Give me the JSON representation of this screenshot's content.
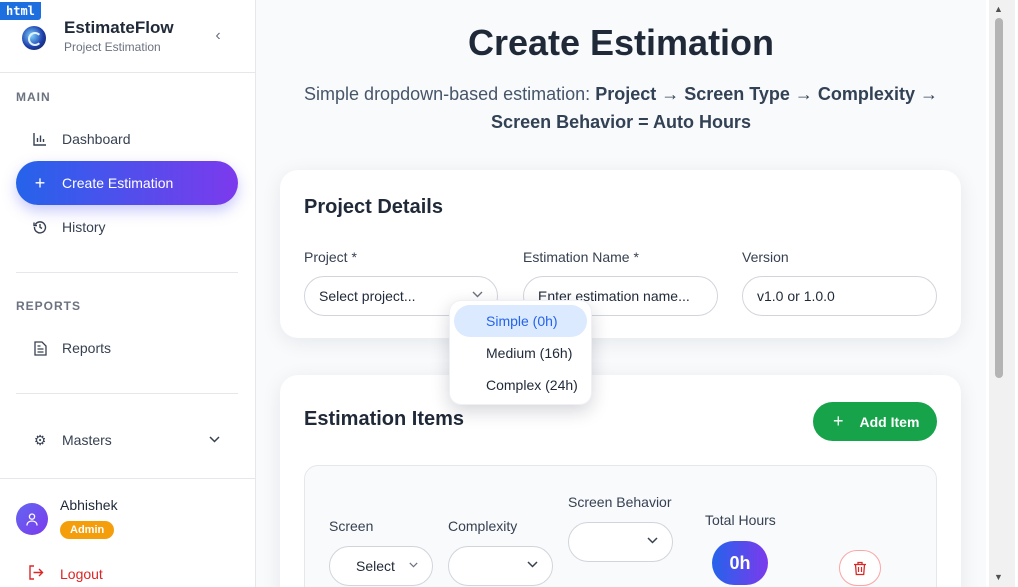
{
  "overlay": {
    "tag": "html"
  },
  "brand": {
    "title": "EstimateFlow",
    "subtitle": "Project Estimation",
    "logo_icon": "swirl-logo-icon"
  },
  "sidebar": {
    "collapse_icon": "chevron-left-icon",
    "main_label": "MAIN",
    "main_items": [
      {
        "label": "Dashboard",
        "icon": "bar-chart-icon"
      },
      {
        "label": "Create Estimation",
        "icon": "plus-icon",
        "active": true
      },
      {
        "label": "History",
        "icon": "history-icon"
      }
    ],
    "reports_label": "REPORTS",
    "reports_items": [
      {
        "label": "Reports",
        "icon": "document-icon"
      }
    ],
    "masters": {
      "label": "Masters",
      "icon": "gear-icon"
    },
    "user": {
      "name": "Abhishek",
      "role": "Admin"
    },
    "logout": "Logout"
  },
  "page": {
    "title": "Create Estimation",
    "subtitle_prefix": "Simple dropdown-based estimation: ",
    "subtitle_flow": "Project → Screen Type → Complexity → Screen Behavior = Auto Hours"
  },
  "project_details": {
    "title": "Project Details",
    "project_label": "Project *",
    "project_value": "Select project...",
    "name_label": "Estimation Name *",
    "name_placeholder": "Enter estimation name...",
    "version_label": "Version",
    "version_placeholder": "v1.0 or 1.0.0"
  },
  "dropdown": {
    "options": [
      "Simple (0h)",
      "Medium (16h)",
      "Complex (24h)"
    ],
    "selected": "Simple (0h)"
  },
  "estimation_items": {
    "title": "Estimation Items",
    "add_button": "Add Item",
    "columns": {
      "screen": "Screen",
      "complexity": "Complexity",
      "behavior": "Screen Behavior",
      "total": "Total Hours"
    },
    "row": {
      "screen_value": "Select",
      "complexity_value": "",
      "behavior_value": "",
      "total_hours": "0h"
    }
  },
  "colors": {
    "accent_gradient_start": "#2563eb",
    "accent_gradient_end": "#7c3aed",
    "add_button": "#16a34a",
    "logout": "#dc2626",
    "role_badge": "#f59e0b"
  }
}
